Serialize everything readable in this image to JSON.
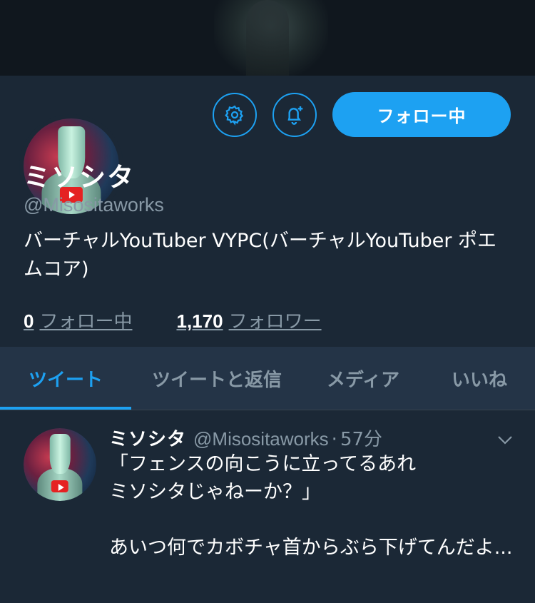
{
  "profile": {
    "name": "ミソシタ",
    "handle": "@Misositaworks",
    "bio": "バーチャルYouTuber VYPC(バーチャルYouTuber ポエムコア)",
    "following_count": "0",
    "following_label": "フォロー中",
    "followers_count": "1,170",
    "followers_label": "フォロワー",
    "follow_button_label": "フォロー中"
  },
  "tabs": [
    {
      "label": "ツイート",
      "active": true
    },
    {
      "label": "ツイートと返信",
      "active": false
    },
    {
      "label": "メディア",
      "active": false
    },
    {
      "label": "いいね",
      "active": false
    }
  ],
  "tweet": {
    "name": "ミソシタ",
    "handle": "@Misositaworks",
    "separator": "·",
    "time": "57分",
    "text": "「フェンスの向こうに立ってるあれ\nミソシタじゃねーか？」\n\nあいつ何でカボチャ首からぶら下げてんだよ..."
  },
  "colors": {
    "accent": "#1da1f2",
    "background": "#1b2836",
    "tab_bar": "#243447",
    "secondary_text": "#8899a6"
  },
  "icons": {
    "settings": "gear-icon",
    "notifications": "bell-plus-icon",
    "menu": "chevron-down-icon"
  }
}
